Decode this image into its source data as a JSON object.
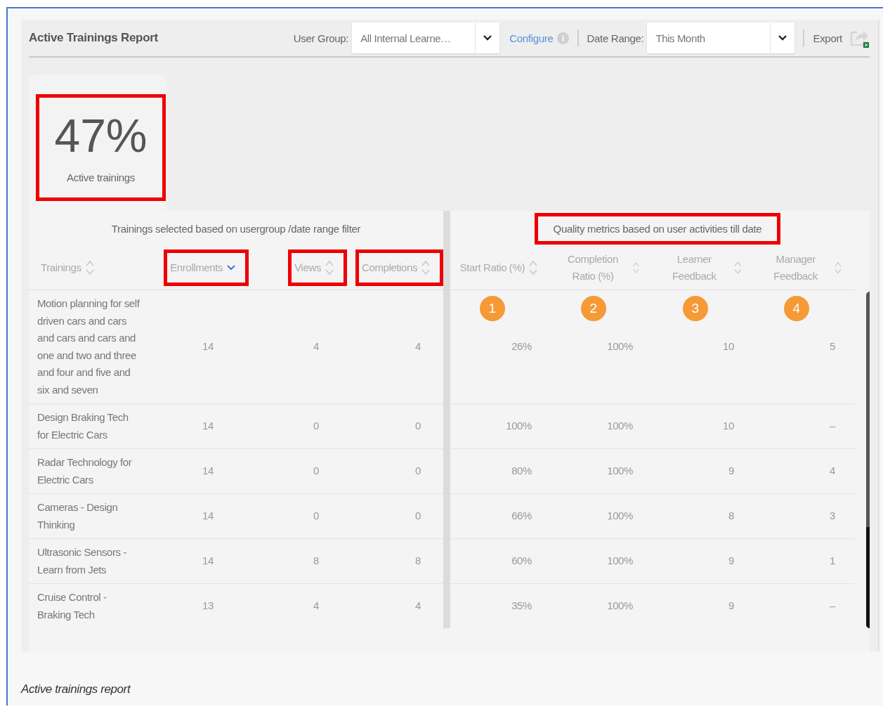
{
  "header": {
    "title": "Active Trainings Report",
    "user_group": {
      "label": "User Group:",
      "value": "All Internal Learne…"
    },
    "configure": "Configure",
    "date_range": {
      "label": "Date Range:",
      "value": "This Month"
    },
    "export": "Export"
  },
  "summary_card": {
    "value": "47%",
    "label": "Active trainings",
    "highlighted": true
  },
  "groups": [
    {
      "title": "Trainings selected based on usergroup /date range filter",
      "highlighted": false,
      "columns": [
        {
          "label": "Trainings",
          "sorted": false,
          "highlighted": false
        },
        {
          "label": "Enrollments",
          "sorted": true,
          "highlighted": true
        },
        {
          "label": "Views",
          "sorted": false,
          "highlighted": true
        },
        {
          "label": "Completions",
          "sorted": false,
          "highlighted": true
        }
      ]
    },
    {
      "title": "Quality metrics based on user activities till date",
      "highlighted": true,
      "columns": [
        {
          "label": "Start Ratio (%)",
          "sorted": false,
          "highlighted": false,
          "marker": "1"
        },
        {
          "label": "Completion Ratio (%)",
          "sorted": false,
          "highlighted": false,
          "marker": "2"
        },
        {
          "label": "Learner Feedback",
          "sorted": false,
          "highlighted": false,
          "marker": "3"
        },
        {
          "label": "Manager Feedback",
          "sorted": false,
          "highlighted": false,
          "marker": "4"
        }
      ]
    }
  ],
  "rows": [
    {
      "cells": [
        "Motion planning for self driven cars and cars and cars and cars and one and two and three and four and five and six and seven",
        "14",
        "4",
        "4",
        "26%",
        "100%",
        "10",
        "5"
      ]
    },
    {
      "cells": [
        "Design Braking Tech for Electric Cars",
        "14",
        "0",
        "0",
        "100%",
        "100%",
        "10",
        "–"
      ]
    },
    {
      "cells": [
        "Radar Technology for Electric Cars",
        "14",
        "0",
        "0",
        "80%",
        "100%",
        "9",
        "4"
      ]
    },
    {
      "cells": [
        "Cameras - Design Thinking",
        "14",
        "0",
        "0",
        "66%",
        "100%",
        "8",
        "3"
      ]
    },
    {
      "cells": [
        "Ultrasonic Sensors - Learn from Jets",
        "14",
        "8",
        "8",
        "60%",
        "100%",
        "9",
        "1"
      ]
    },
    {
      "cells": [
        "Cruise Control - Braking Tech",
        "13",
        "4",
        "4",
        "35%",
        "100%",
        "9",
        "–"
      ]
    }
  ],
  "caption": "Active trainings report"
}
